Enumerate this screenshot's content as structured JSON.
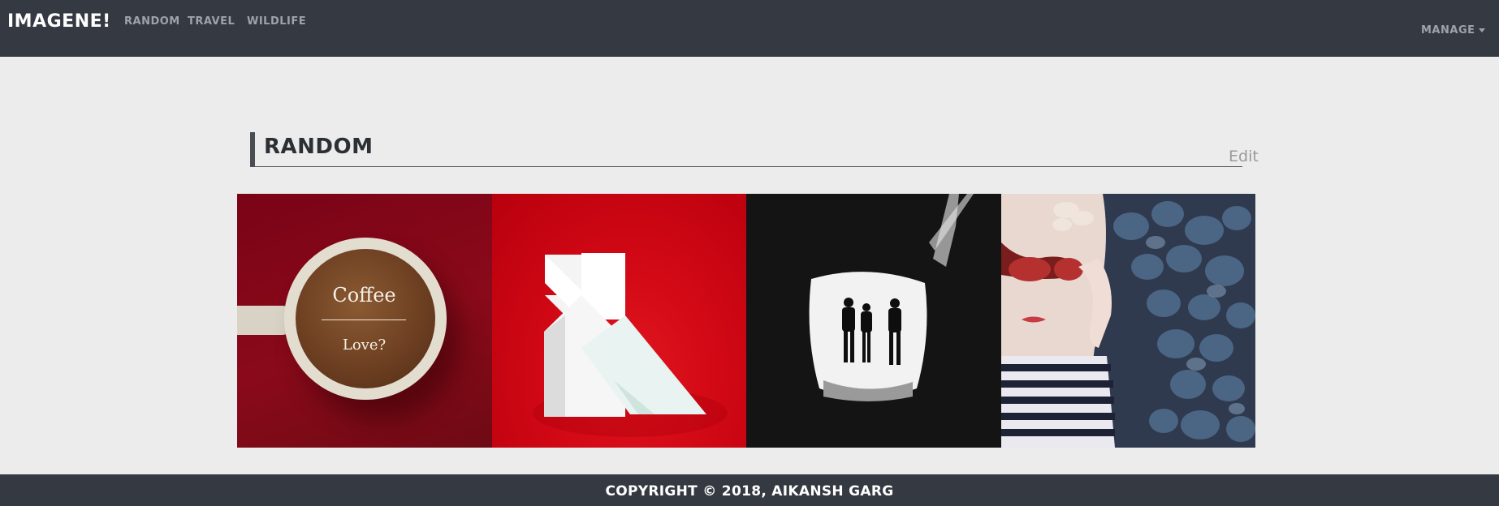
{
  "navbar": {
    "brand": "IMAGENE!",
    "links": [
      "RANDOM",
      "TRAVEL",
      "WILDLIFE"
    ],
    "manage_label": "MANAGE"
  },
  "section": {
    "title": "RANDOM",
    "edit_label": "Edit"
  },
  "gallery": {
    "tiles": [
      {
        "caption_line1": "Coffee",
        "caption_line2": "Love?"
      },
      {},
      {},
      {}
    ]
  },
  "footer": {
    "copyright": "COPYRIGHT © 2018, AIKANSH GARG"
  },
  "colors": {
    "navbar": "#353a42",
    "page_background": "#ececec",
    "nav_link": "#9ea3aa"
  }
}
